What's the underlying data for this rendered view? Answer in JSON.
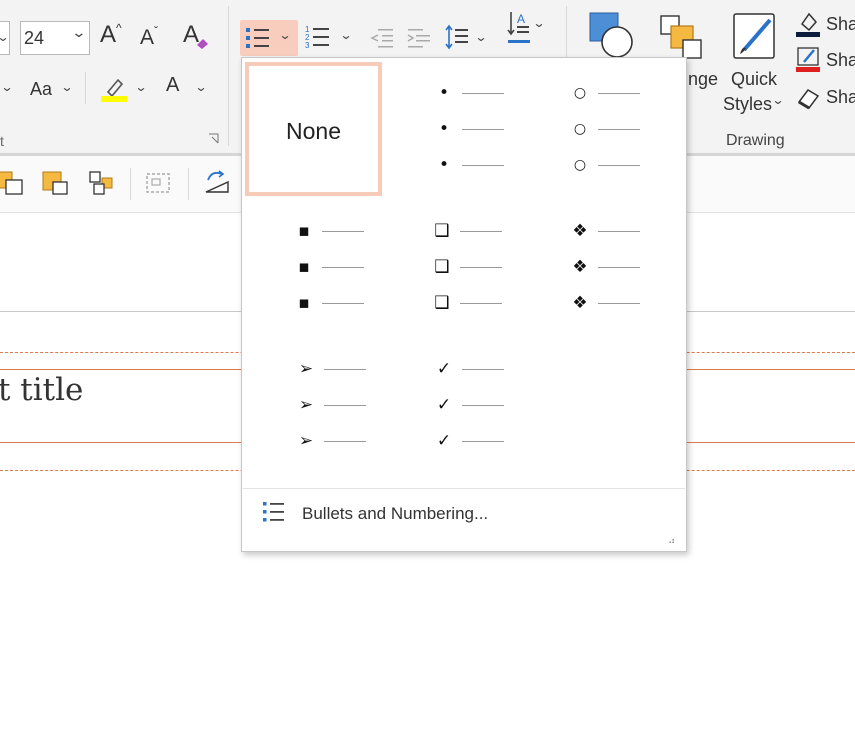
{
  "ribbon": {
    "font_size": "24",
    "font_case_label": "Aa",
    "font_color_label": "A",
    "grow_font_label": "A",
    "shrink_font_label": "A",
    "clear_format_label": "A",
    "arrange_label": "nge",
    "quick_styles_line1": "Quick",
    "quick_styles_line2": "Styles",
    "drawing_group_label": "Drawing",
    "shape_fill_label": "Sha",
    "shape_outline_label": "Sha",
    "shape_effects_label": "Sha",
    "chevron": "⌄",
    "group_corner": "t",
    "accent_color": "#f8cdbd",
    "highlight_color": "#ffff00",
    "outline_red": "#e02020"
  },
  "slide": {
    "title_text": "t title"
  },
  "bullets_menu": {
    "none_label": "None",
    "options": [
      {
        "name": "none",
        "symbol": ""
      },
      {
        "name": "filled-round",
        "symbol": "•"
      },
      {
        "name": "hollow-round",
        "symbol": "○"
      },
      {
        "name": "filled-square",
        "symbol": "▪"
      },
      {
        "name": "hollow-square",
        "symbol": "❑"
      },
      {
        "name": "star-diamond",
        "symbol": "❖"
      },
      {
        "name": "arrow",
        "symbol": "➢"
      },
      {
        "name": "checkmark",
        "symbol": "✓"
      }
    ],
    "footer_label": "Bullets and Numbering..."
  }
}
